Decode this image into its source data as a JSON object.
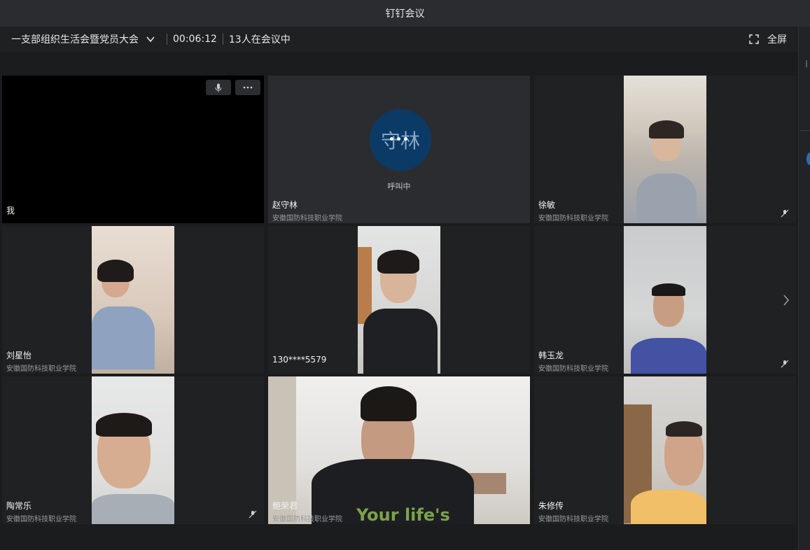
{
  "window": {
    "title": "钉钉会议"
  },
  "header": {
    "meeting_name": "一支部组织生活会暨党员大会",
    "timer": "00:06:12",
    "participant_count": "13人在会议中",
    "fullscreen_label": "全屏"
  },
  "tiles": [
    {
      "name": "我",
      "org": ""
    },
    {
      "name": "赵守林",
      "org": "安徽国防科技职业学院",
      "avatar_text": "守林",
      "status": "呼叫中"
    },
    {
      "name": "徐敏",
      "org": "安徽国防科技职业学院"
    },
    {
      "name": "刘星怡",
      "org": "安徽国防科技职业学院"
    },
    {
      "name": "130****5579",
      "org": ""
    },
    {
      "name": "韩玉龙",
      "org": "安徽国防科技职业学院"
    },
    {
      "name": "陶常乐",
      "org": "安徽国防科技职业学院"
    },
    {
      "name": "鲍荣君",
      "org": "安徽国防科技职业学院",
      "shirt_text": "Your life's"
    },
    {
      "name": "朱修传",
      "org": "安徽国防科技职业学院"
    }
  ],
  "icons": {
    "dropdown": "chevron-down-icon",
    "fullscreen": "fullscreen-icon",
    "mic": "microphone-icon",
    "more": "more-icon",
    "muted": "mic-muted-icon",
    "next": "chevron-right-icon"
  },
  "colors": {
    "background": "#1b1c1e",
    "tile": "#202123",
    "avatar": "#0c3a66"
  }
}
